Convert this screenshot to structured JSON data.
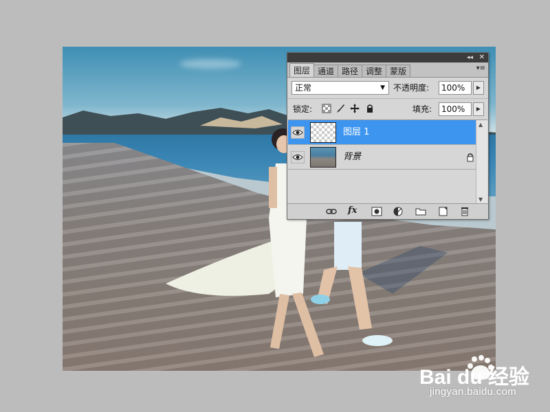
{
  "panel": {
    "tabs": [
      {
        "label": "图层",
        "active": true
      },
      {
        "label": "通道",
        "active": false
      },
      {
        "label": "路径",
        "active": false
      },
      {
        "label": "调整",
        "active": false
      },
      {
        "label": "蒙版",
        "active": false
      }
    ],
    "collapse_glyph": "◂◂",
    "close_glyph": "✕",
    "menu_glyph": "▾≡",
    "blend_mode": "正常",
    "opacity_label": "不透明度:",
    "opacity_value": "100%",
    "lock_label": "锁定:",
    "fill_label": "填充:",
    "fill_value": "100%",
    "layers": [
      {
        "name": "图层 1",
        "selected": true,
        "thumbnail": "transparent"
      },
      {
        "name": "背景",
        "selected": false,
        "thumbnail": "photo",
        "locked": true
      }
    ],
    "footer_icons": [
      "link-icon",
      "fx-icon",
      "mask-icon",
      "adjustment-icon",
      "folder-icon",
      "new-layer-icon",
      "trash-icon"
    ],
    "fx_text": "fx"
  },
  "watermark": {
    "brand": "Bai du 经验",
    "url": "jingyan.baidu.com"
  },
  "colors": {
    "selected_layer": "#3d95f0",
    "panel_bg": "#d6d6d6",
    "page_bg": "#bcbcbc"
  }
}
